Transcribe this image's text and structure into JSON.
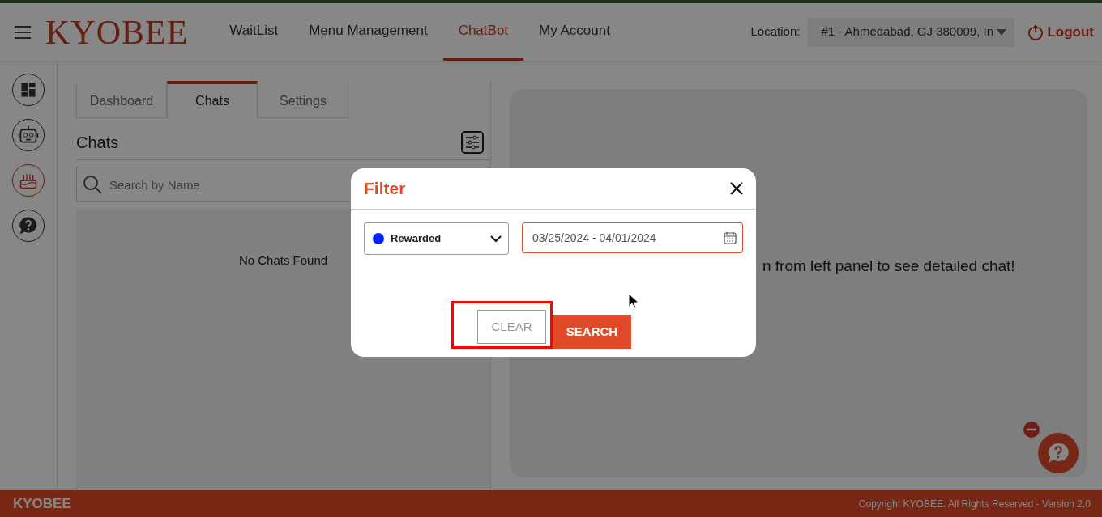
{
  "nav": {
    "brand": "KYOBEE",
    "links": [
      {
        "label": "WaitList",
        "selected": false
      },
      {
        "label": "Menu Management",
        "selected": false
      },
      {
        "label": "ChatBot",
        "selected": true
      },
      {
        "label": "My Account",
        "selected": false
      }
    ],
    "location_label": "Location:",
    "location_value": "#1 - Ahmedabad, GJ 380009, In",
    "logout": "Logout"
  },
  "sidebar": {
    "items": [
      {
        "kind": "dashboard",
        "selected": false
      },
      {
        "kind": "robot",
        "selected": false
      },
      {
        "kind": "cake",
        "selected": true
      },
      {
        "kind": "help",
        "selected": false
      }
    ]
  },
  "tabs": [
    {
      "label": "Dashboard",
      "selected": false
    },
    {
      "label": "Chats",
      "selected": true
    },
    {
      "label": "Settings",
      "selected": false
    }
  ],
  "chats": {
    "title": "Chats",
    "search": {
      "placeholder": "Search by Name"
    },
    "empty": "No Chats Found"
  },
  "detail": {
    "message": "n from left panel to see detailed chat!"
  },
  "filter_dialog": {
    "title": "Filter",
    "status": {
      "value": "Rewarded",
      "color": "#0022ff"
    },
    "date_range": "03/25/2024 - 04/01/2024",
    "buttons": [
      {
        "label": "CLEAR",
        "kind": "outline",
        "highlighted": true
      },
      {
        "label": "SEARCH",
        "kind": "primary",
        "highlighted": false
      }
    ]
  },
  "footer": {
    "brand": "KYOBEE",
    "copyright": "Copyright KYOBEE. All Rights Reserved - Version 2.0"
  }
}
